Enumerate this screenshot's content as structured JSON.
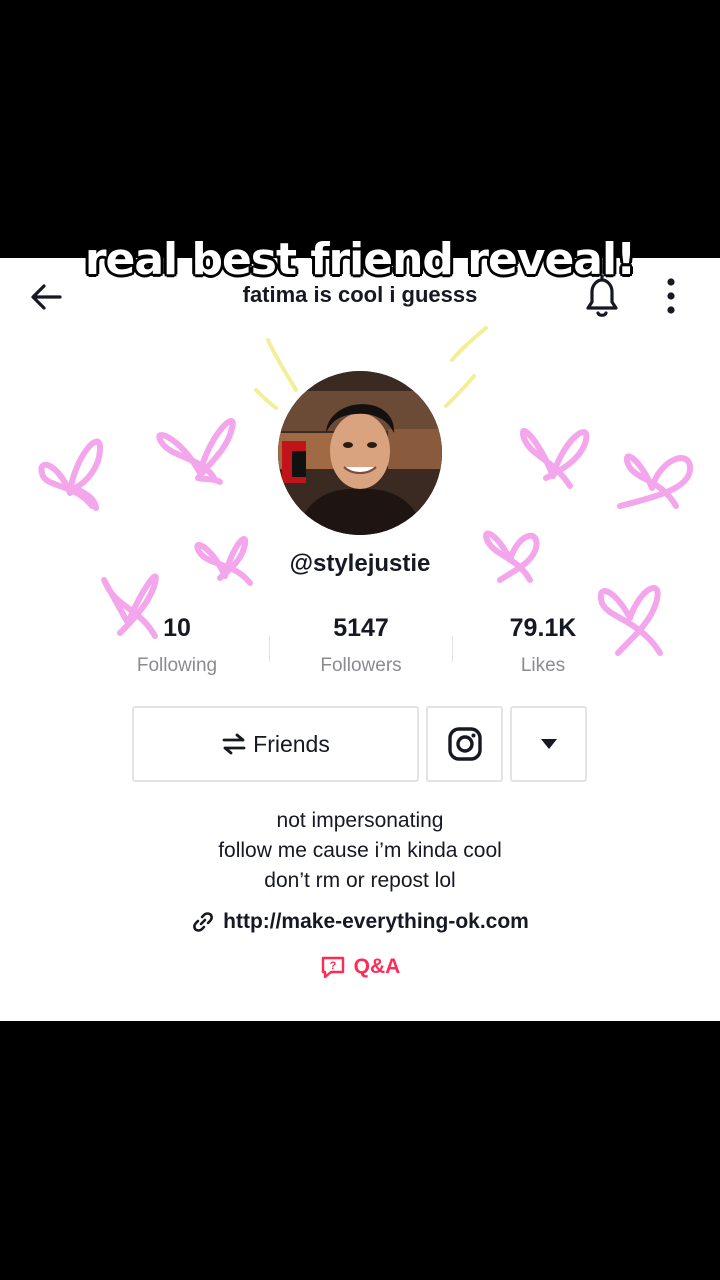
{
  "caption": "real best friend reveal!",
  "header": {
    "back_icon": "arrow-left-icon",
    "profile_name": "fatima is cool i guesss",
    "bell_icon": "bell-icon",
    "more_icon": "more-vertical-icon"
  },
  "profile": {
    "username": "@stylejustie",
    "avatar_icon": "avatar-photo"
  },
  "stats": {
    "following": {
      "value": "10",
      "label": "Following"
    },
    "followers": {
      "value": "5147",
      "label": "Followers"
    },
    "likes": {
      "value": "79.1K",
      "label": "Likes"
    }
  },
  "actions": {
    "friends_icon": "swap-arrows-icon",
    "friends_label": "Friends",
    "instagram_icon": "instagram-icon",
    "dropdown_icon": "caret-down-icon"
  },
  "bio": {
    "lines": [
      "not impersonating",
      "follow me cause i’m kinda cool",
      "don’t rm or repost lol"
    ]
  },
  "link": {
    "icon": "link-icon",
    "url": "http://make-everything-ok.com"
  },
  "qa": {
    "icon": "qa-icon",
    "label": "Q&A"
  },
  "colors": {
    "accent": "#fe2c55",
    "doodle_pink": "#f4a6ec",
    "doodle_yellow": "#f2ef9a",
    "text": "#161823",
    "muted": "#8a8b91"
  }
}
